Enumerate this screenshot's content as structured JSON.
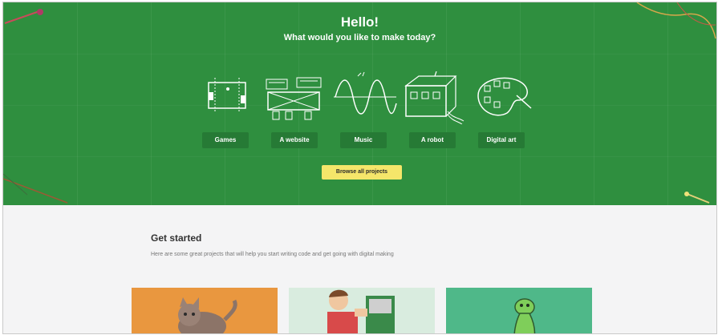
{
  "hero": {
    "title": "Hello!",
    "subtitle": "What would you like to make today?",
    "categories": [
      {
        "label": "Games",
        "icon": "game-board-icon"
      },
      {
        "label": "A website",
        "icon": "website-buildings-icon"
      },
      {
        "label": "Music",
        "icon": "sound-wave-icon"
      },
      {
        "label": "A robot",
        "icon": "robot-icon"
      },
      {
        "label": "Digital art",
        "icon": "paint-palette-icon"
      }
    ],
    "browse_label": "Browse all projects"
  },
  "get_started": {
    "title": "Get started",
    "description": "Here are some great projects that will help you start writing code and get going with digital making"
  },
  "cards": [
    {
      "name": "cat-project-card",
      "background": "#e9973f"
    },
    {
      "name": "boy-project-card",
      "background": "#d9ecdf"
    },
    {
      "name": "turtle-project-card",
      "background": "#4fb889"
    }
  ],
  "colors": {
    "hero_background": "#2f8f3f",
    "category_button": "#267a35",
    "browse_button": "#f5e66a",
    "page_background": "#f4f4f5"
  }
}
